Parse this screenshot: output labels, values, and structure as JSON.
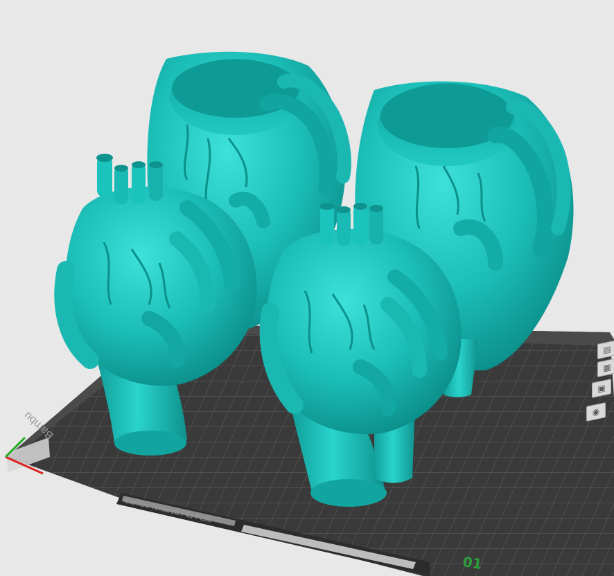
{
  "scene": {
    "background_color": "#e8e8e8",
    "model_color": "#1ec2bc",
    "plate_color": "#3a3a3a",
    "grid_color": "#6a6a6a"
  },
  "plate": {
    "number_label": "01",
    "brand_label": "Bambu Textured PEI Plate",
    "side_label": "Bambu"
  },
  "models": [
    {
      "name": "heart-in-hands-vase-back-left"
    },
    {
      "name": "heart-in-hands-vase-back-right"
    },
    {
      "name": "heart-in-hands-vase-front-left"
    },
    {
      "name": "heart-in-hands-vase-front-right"
    }
  ],
  "toolbar": {
    "icons": [
      "plate-settings-icon",
      "arrange-icon",
      "lock-plate-icon",
      "view-plate-icon"
    ]
  }
}
